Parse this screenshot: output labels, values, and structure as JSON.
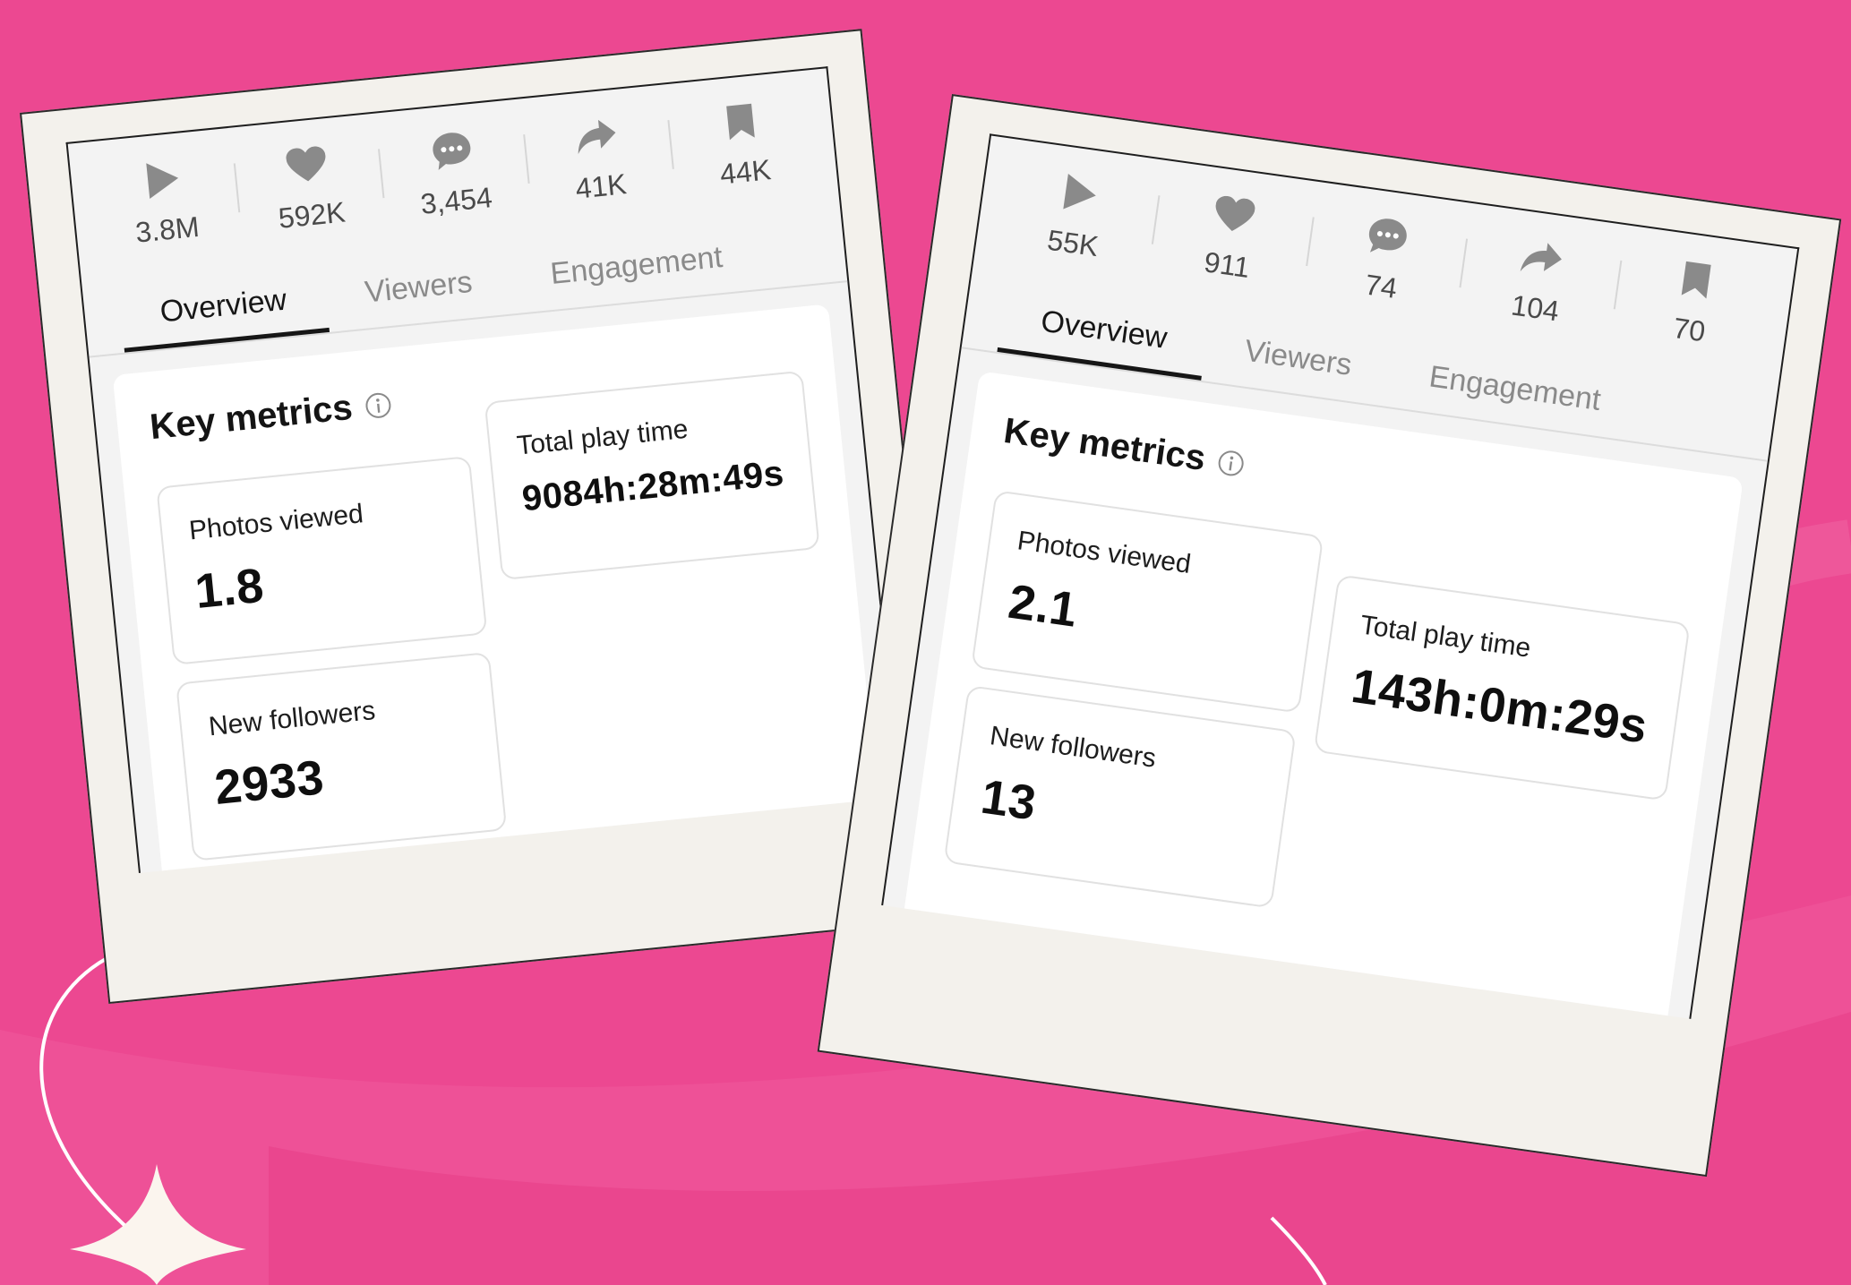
{
  "colors": {
    "background": "#ec4891",
    "frame": "#f3f1ec",
    "text_primary": "#141414",
    "text_muted": "#8a8a8a"
  },
  "left": {
    "stats": [
      {
        "icon": "play-icon",
        "value": "3.8M"
      },
      {
        "icon": "heart-icon",
        "value": "592K"
      },
      {
        "icon": "comment-icon",
        "value": "3,454"
      },
      {
        "icon": "share-icon",
        "value": "41K"
      },
      {
        "icon": "bookmark-icon",
        "value": "44K"
      }
    ],
    "tabs": [
      "Overview",
      "Viewers",
      "Engagement"
    ],
    "key_metrics_title": "Key metrics",
    "metrics": {
      "photos_viewed": {
        "label": "Photos viewed",
        "value": "1.8"
      },
      "total_play_time": {
        "label": "Total play time",
        "value": "9084h:28m:49s"
      },
      "new_followers": {
        "label": "New followers",
        "value": "2933"
      }
    }
  },
  "right": {
    "stats": [
      {
        "icon": "play-icon",
        "value": "55K"
      },
      {
        "icon": "heart-icon",
        "value": "911"
      },
      {
        "icon": "comment-icon",
        "value": "74"
      },
      {
        "icon": "share-icon",
        "value": "104"
      },
      {
        "icon": "bookmark-icon",
        "value": "70"
      }
    ],
    "tabs": [
      "Overview",
      "Viewers",
      "Engagement"
    ],
    "key_metrics_title": "Key metrics",
    "metrics": {
      "photos_viewed": {
        "label": "Photos viewed",
        "value": "2.1"
      },
      "total_play_time": {
        "label": "Total play time",
        "value": "143h:0m:29s"
      },
      "new_followers": {
        "label": "New followers",
        "value": "13"
      }
    }
  }
}
